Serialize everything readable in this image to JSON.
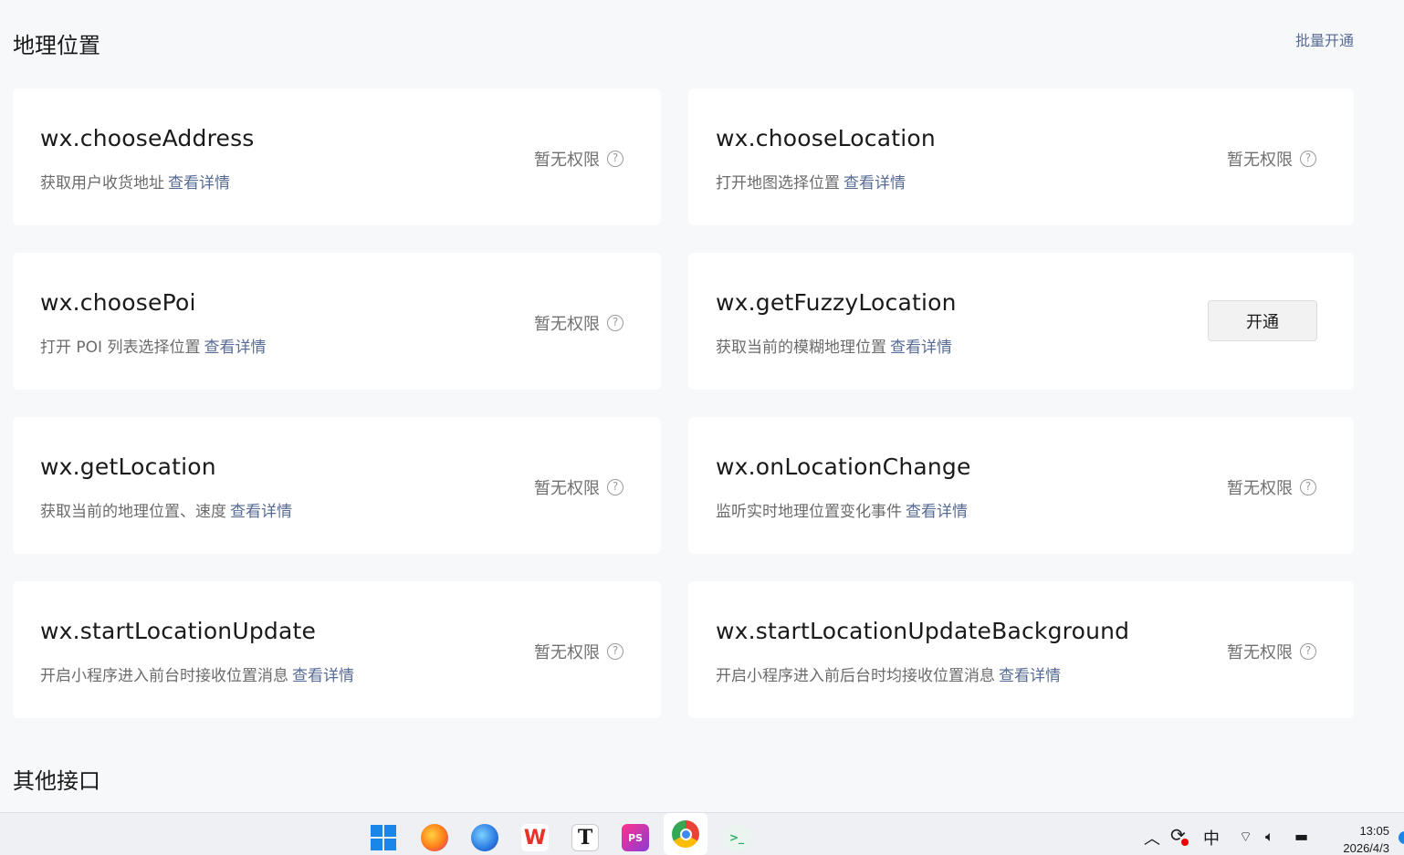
{
  "section_geo": {
    "title": "地理位置",
    "batch_label": "批量开通"
  },
  "section_other": {
    "title": "其他接口"
  },
  "detail_label": "查看详情",
  "no_permission_label": "暂无权限",
  "help_glyph": "?",
  "open_label": "开通",
  "apis": [
    {
      "name": "wx.chooseAddress",
      "desc": "获取用户收货地址"
    },
    {
      "name": "wx.chooseLocation",
      "desc": "打开地图选择位置"
    },
    {
      "name": "wx.choosePoi",
      "desc": "打开 POI 列表选择位置"
    },
    {
      "name": "wx.getFuzzyLocation",
      "desc": "获取当前的模糊地理位置"
    },
    {
      "name": "wx.getLocation",
      "desc": "获取当前的地理位置、速度"
    },
    {
      "name": "wx.onLocationChange",
      "desc": "监听实时地理位置变化事件"
    },
    {
      "name": "wx.startLocationUpdate",
      "desc": "开启小程序进入前台时接收位置消息"
    },
    {
      "name": "wx.startLocationUpdateBackground",
      "desc": "开启小程序进入前后台时均接收位置消息"
    }
  ],
  "taskbar": {
    "apps": [
      {
        "icon": "windows-start-icon"
      },
      {
        "icon": "firefox-icon",
        "color": "#ff7a1a"
      },
      {
        "icon": "firefox-dev-icon",
        "color": "#2a7ae2"
      },
      {
        "icon": "wps-icon",
        "color": "#e8322b",
        "glyph": "W"
      },
      {
        "icon": "typora-icon",
        "color": "#1a1a1a",
        "glyph": "T"
      },
      {
        "icon": "phpstorm-icon",
        "color": "#b53bd6",
        "glyph": "PS"
      },
      {
        "icon": "chrome-icon"
      },
      {
        "icon": "wechat-devtools-icon",
        "color": "#2aae67",
        "glyph": ">_"
      }
    ],
    "tray": {
      "ime": "中",
      "time": "13:05",
      "date": "2026/4/3"
    }
  }
}
